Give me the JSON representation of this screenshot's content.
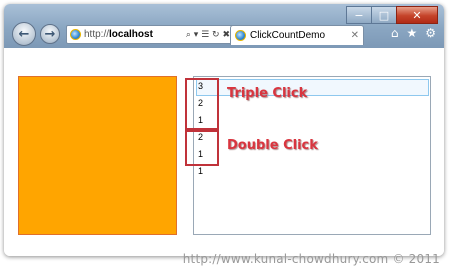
{
  "window": {
    "controls": {
      "minimize": "−",
      "maximize": "□",
      "close": "✕"
    }
  },
  "nav": {
    "back_icon": "←",
    "forward_icon": "→"
  },
  "address_bar": {
    "url_prefix": "http://",
    "url_host": "localhost",
    "tools": "⌕ ▾ ☰ ↻ ✖"
  },
  "tab": {
    "title": "ClickCountDemo",
    "close_icon": "✕"
  },
  "toolbar": {
    "home_icon": "⌂",
    "favorites_icon": "★",
    "tools_icon": "⚙"
  },
  "listbox": {
    "items": [
      "3",
      "2",
      "1",
      "2",
      "1",
      "1"
    ]
  },
  "annotations": {
    "triple": "Triple Click",
    "double": "Double Click"
  },
  "watermark": "http://www.kunal-chowdhury.com © 2011",
  "colors": {
    "box": "#ffa500",
    "annotation": "#d9353f",
    "selection": "#8ec8ee"
  }
}
